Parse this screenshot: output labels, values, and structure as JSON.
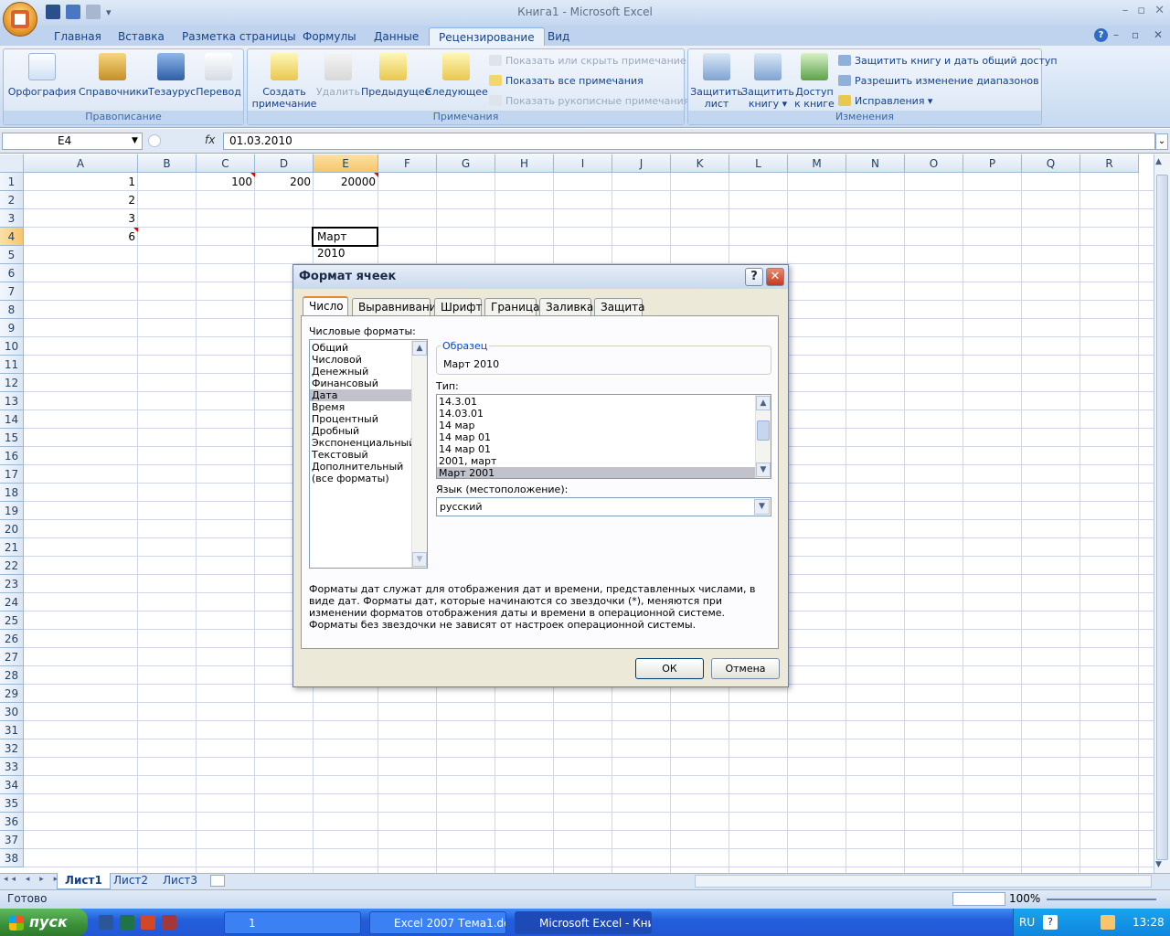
{
  "window": {
    "title": "Книга1 - Microsoft Excel"
  },
  "ribbon_tabs": [
    "Главная",
    "Вставка",
    "Разметка страницы",
    "Формулы",
    "Данные",
    "Рецензирование",
    "Вид"
  ],
  "ribbon": {
    "spelling": {
      "label": "Правописание",
      "buttons": [
        "Орфография",
        "Справочники",
        "Тезаурус",
        "Перевод"
      ]
    },
    "comments": {
      "label": "Примечания",
      "create": "Создать примечание",
      "create_l1": "Создать",
      "create_l2": "примечание",
      "delete": "Удалить",
      "prev": "Предыдущее",
      "next": "Следующее",
      "show_hide": "Показать или скрыть примечание",
      "show_all": "Показать все примечания",
      "show_ink": "Показать рукописные примечания"
    },
    "changes": {
      "label": "Изменения",
      "protect_sheet_l1": "Защитить",
      "protect_sheet_l2": "лист",
      "protect_book_l1": "Защитить",
      "protect_book_l2": "книгу",
      "share_l1": "Доступ",
      "share_l2": "к книге",
      "protect_share": "Защитить книгу и дать общий доступ",
      "allow_ranges": "Разрешить изменение диапазонов",
      "track": "Исправления"
    }
  },
  "formula_bar": {
    "name_box": "E4",
    "fx": "fx",
    "formula": "01.03.2010"
  },
  "columns": [
    "A",
    "B",
    "C",
    "D",
    "E",
    "F",
    "G",
    "H",
    "I",
    "J",
    "K",
    "L",
    "M",
    "N",
    "O",
    "P",
    "Q",
    "R"
  ],
  "rows": [
    "1",
    "2",
    "3",
    "4",
    "5",
    "6",
    "7",
    "8",
    "9",
    "10",
    "11",
    "12",
    "13",
    "14",
    "15",
    "16",
    "17",
    "18",
    "19",
    "20",
    "21",
    "22",
    "23",
    "24",
    "25",
    "26",
    "27",
    "28",
    "29",
    "30",
    "31",
    "32",
    "33",
    "34",
    "35",
    "36",
    "37",
    "38"
  ],
  "cells": {
    "A1": "1",
    "A2": "2",
    "A3": "3",
    "A4": "6",
    "C1": "100",
    "D1": "200",
    "E1": "20000",
    "E4": "Март 2010"
  },
  "sheets": [
    "Лист1",
    "Лист2",
    "Лист3"
  ],
  "status": {
    "ready": "Готово",
    "zoom": "100%"
  },
  "taskbar": {
    "start": "пуск",
    "items": [
      "1",
      "Excel 2007 Тема1.do...",
      "Microsoft Excel - Кни..."
    ],
    "lang": "RU",
    "time": "13:28"
  },
  "dialog": {
    "title": "Формат ячеек",
    "tabs": [
      "Число",
      "Выравнивание",
      "Шрифт",
      "Граница",
      "Заливка",
      "Защита"
    ],
    "formats_label": "Числовые форматы:",
    "formats": [
      "Общий",
      "Числовой",
      "Денежный",
      "Финансовый",
      "Дата",
      "Время",
      "Процентный",
      "Дробный",
      "Экспоненциальный",
      "Текстовый",
      "Дополнительный",
      "(все форматы)"
    ],
    "selected_format": "Дата",
    "sample_label": "Образец",
    "sample_value": "Март 2010",
    "type_label": "Тип:",
    "types": [
      "14.3.01",
      "14.03.01",
      "14 мар",
      "14 мар 01",
      "14 мар 01",
      "2001, март",
      "Март 2001"
    ],
    "selected_type": "Март 2001",
    "lang_label": "Язык (местоположение):",
    "lang_value": "русский",
    "description": "Форматы дат служат для отображения дат и времени, представленных числами, в виде дат. Форматы дат, которые начинаются со звездочки (*), меняются при изменении форматов отображения даты и времени в операционной системе. Форматы без звездочки не зависят от настроек операционной системы.",
    "ok": "ОК",
    "cancel": "Отмена",
    "help": "?",
    "close": "✕"
  }
}
